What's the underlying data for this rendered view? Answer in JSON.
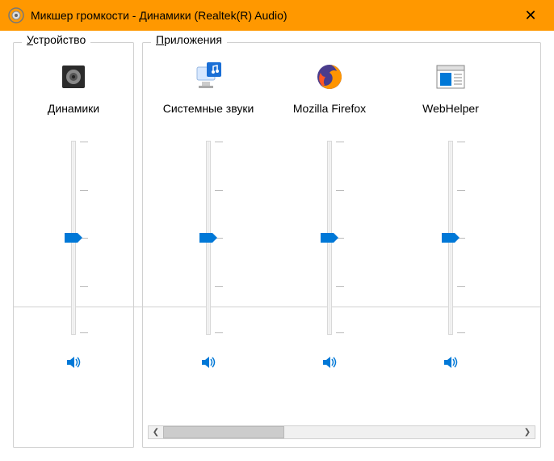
{
  "window": {
    "title": "Микшер громкости - Динамики (Realtek(R) Audio)"
  },
  "device_section": {
    "label": "стройство",
    "label_underline": "У",
    "channel": {
      "name": "Динамики",
      "volume": 50,
      "muted": false
    }
  },
  "apps_section": {
    "label": "риложения",
    "label_underline": "П",
    "channels": [
      {
        "name": "Системные звуки",
        "volume": 50,
        "muted": false,
        "icon": "system-sounds"
      },
      {
        "name": "Mozilla Firefox",
        "volume": 50,
        "muted": false,
        "icon": "firefox"
      },
      {
        "name": "WebHelper",
        "volume": 50,
        "muted": false,
        "icon": "webhelper"
      }
    ]
  }
}
